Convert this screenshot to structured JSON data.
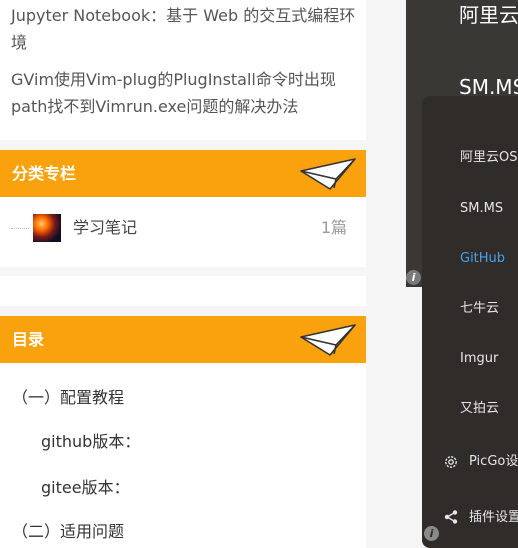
{
  "articles": [
    "Jupyter Notebook：基于 Web 的交互式编程环境",
    "GVim使用Vim-plug的PlugInstall命令时出现path找不到Vimrun.exe问题的解决办法"
  ],
  "category": {
    "title": "分类专栏",
    "items": [
      {
        "name": "学习笔记",
        "count": "1篇"
      }
    ]
  },
  "toc": {
    "title": "目录",
    "items": [
      "（一）配置教程",
      "github版本：",
      "gitee版本：",
      "（二）适用问题"
    ]
  },
  "picgo": {
    "bg_labels": [
      "阿里云",
      "SM.MS"
    ],
    "menu": [
      "阿里云OSS",
      "SM.MS",
      "GitHub",
      "七牛云",
      "Imgur",
      "又拍云",
      "PicGo设置",
      "插件设置"
    ],
    "active_item": "GitHub",
    "info_glyph": "i"
  },
  "colors": {
    "accent_orange": "#f9a20d",
    "menu_bg": "#2f2c2a",
    "menu_active": "#4aa0ea"
  }
}
